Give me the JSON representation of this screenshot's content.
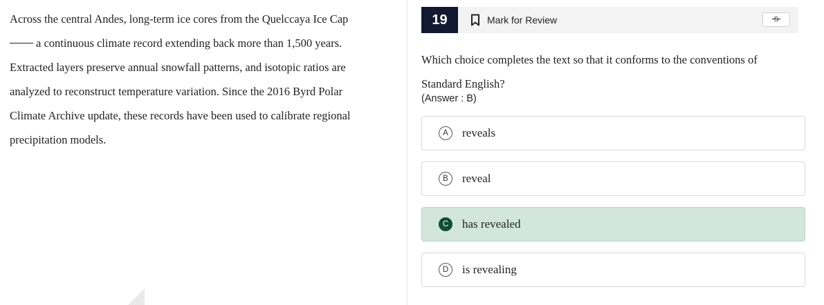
{
  "passage": {
    "line1": "Across the central Andes, long-term ice cores from the Quelccaya Ice Cap",
    "line2_after_blank": "a continuous climate record extending back more than 1,500 years.",
    "line3": "Extracted layers preserve annual snowfall patterns, and isotopic ratios are",
    "line4": "analyzed to reconstruct temperature variation. Since the 2016 Byrd Polar",
    "line5": "Climate Archive update, these records have been used to calibrate regional",
    "line6": "precipitation models."
  },
  "header": {
    "question_number": "19",
    "mark_for_review_label": "Mark for Review",
    "bookmark_icon": "bookmark-icon",
    "strikethrough_icon": "strikethrough-icon"
  },
  "question": {
    "line1": "Which choice completes the text so that it conforms to the conventions of",
    "line2": "Standard English?",
    "answer_note": "(Answer : B)"
  },
  "choices": [
    {
      "letter": "A",
      "text": "reveals",
      "selected": false
    },
    {
      "letter": "B",
      "text": "reveal",
      "selected": false
    },
    {
      "letter": "C",
      "text": "has revealed",
      "selected": true
    },
    {
      "letter": "D",
      "text": "is revealing",
      "selected": false
    }
  ],
  "colors": {
    "question_number_bg": "#141932",
    "selected_choice_bg": "#d2e6dc",
    "selected_letter_bg": "#0f4d35"
  }
}
